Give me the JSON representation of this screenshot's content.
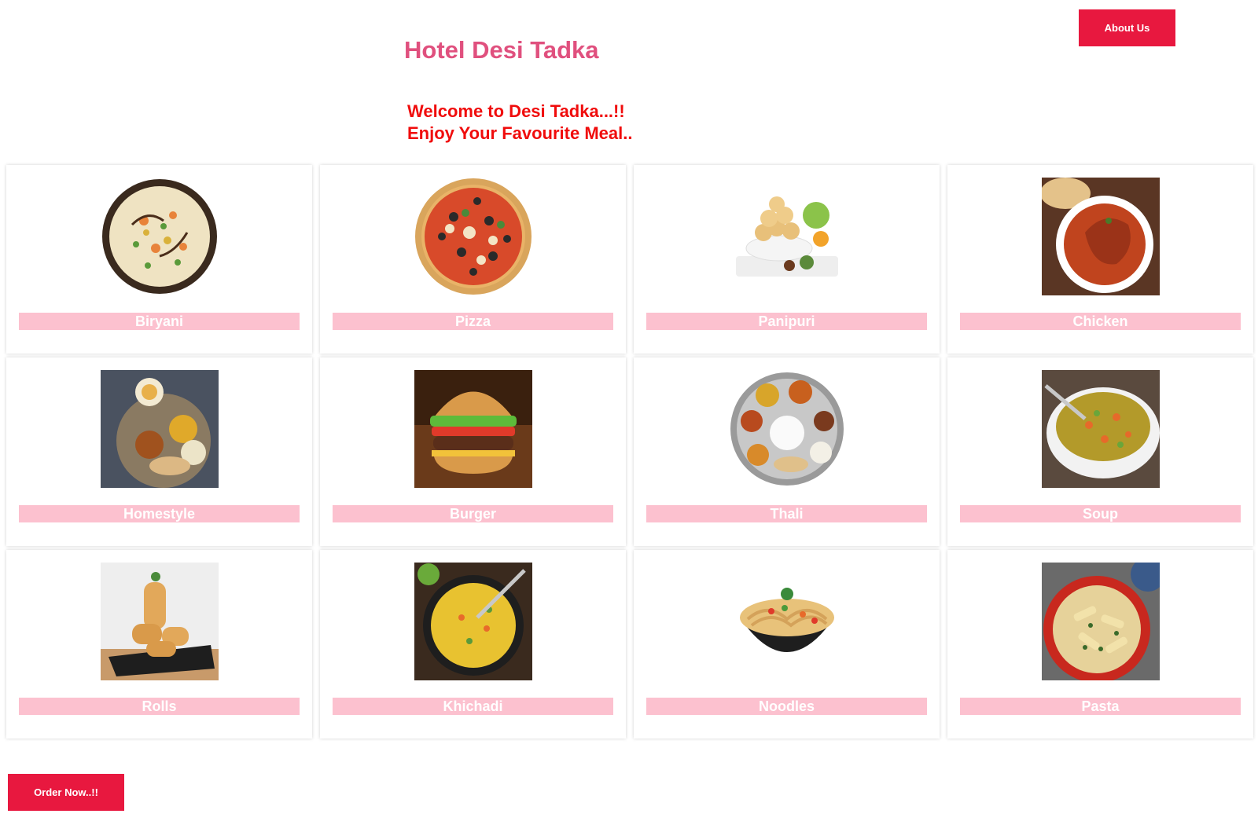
{
  "header": {
    "title": "Hotel Desi Tadka",
    "about_label": "About Us"
  },
  "welcome": {
    "line1": "Welcome to Desi Tadka...!!",
    "line2": "Enjoy Your Favourite Meal.."
  },
  "menu": {
    "items": [
      {
        "label": "Biryani",
        "image": "biryani-bowl-image"
      },
      {
        "label": "Pizza",
        "image": "pizza-image"
      },
      {
        "label": "Panipuri",
        "image": "panipuri-plate-image"
      },
      {
        "label": "Chicken",
        "image": "chicken-curry-image"
      },
      {
        "label": "Homestyle",
        "image": "homestyle-meal-image"
      },
      {
        "label": "Burger",
        "image": "burger-image"
      },
      {
        "label": "Thali",
        "image": "thali-plate-image"
      },
      {
        "label": "Soup",
        "image": "soup-bowl-image"
      },
      {
        "label": "Rolls",
        "image": "spring-rolls-image"
      },
      {
        "label": "Khichadi",
        "image": "khichadi-pan-image"
      },
      {
        "label": "Noodles",
        "image": "noodles-bowl-image"
      },
      {
        "label": "Pasta",
        "image": "pasta-plate-image"
      }
    ]
  },
  "footer": {
    "order_label": "Order Now..!!"
  },
  "colors": {
    "accent": "#e8183f",
    "title": "#e0507e",
    "welcome": "#f00c0c",
    "label_bg": "#fcc1cf"
  }
}
